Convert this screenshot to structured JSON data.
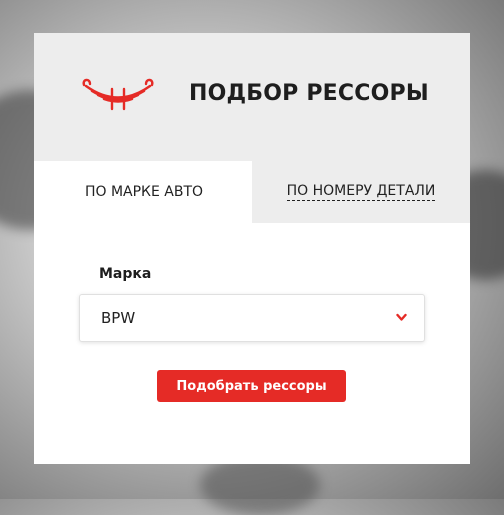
{
  "header": {
    "title": "ПОДБОР РЕССОРЫ",
    "logo_icon": "leaf-spring-icon",
    "brand_color": "#e52b26"
  },
  "tabs": [
    {
      "label": "ПО МАРКЕ АВТО",
      "active": true
    },
    {
      "label": "ПО НОМЕРУ ДЕТАЛИ",
      "active": false
    }
  ],
  "form": {
    "brand_label": "Марка",
    "brand_value": "BPW",
    "dropdown_icon": "chevron-down-icon",
    "submit_label": "Подобрать рессоры"
  }
}
